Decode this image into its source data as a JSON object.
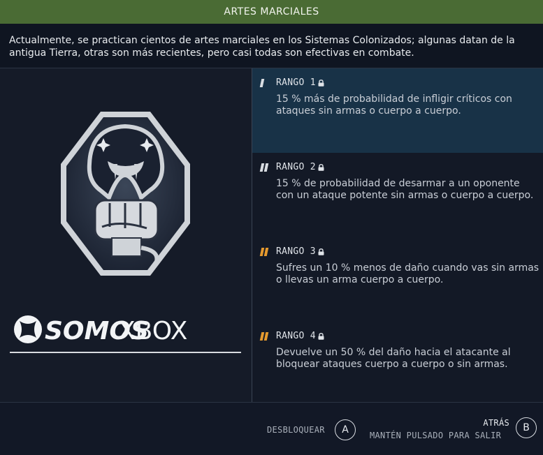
{
  "header": {
    "title": "ARTES MARCIALES"
  },
  "description": "Actualmente, se practican cientos de artes marciales en los Sistemas Colonizados; algunas datan de la antigua Tierra, otras son más recientes, pero casi todas son efectivas en combate.",
  "badge": {
    "icon": "snake-fist-emblem-icon"
  },
  "watermark": {
    "brand": "SOMOSXBOX",
    "text_bold": "SOMOS",
    "text_light": "XBOX"
  },
  "ranks": [
    {
      "label": "RANGO 1",
      "description": "15 % más de probabilidad de infligir críticos con ataques sin armas o cuerpo a cuerpo.",
      "bars": 1,
      "locked": true,
      "selected": true
    },
    {
      "label": "RANGO 2",
      "description": "15 % de probabilidad de desarmar a un oponente con un ataque potente sin armas o cuerpo a cuerpo.",
      "bars": 2,
      "locked": true,
      "selected": false
    },
    {
      "label": "RANGO 3",
      "description": "Sufres un 10 % menos de daño cuando vas sin armas o llevas un arma cuerpo a cuerpo.",
      "bars": 3,
      "locked": true,
      "selected": false
    },
    {
      "label": "RANGO 4",
      "description": "Devuelve un 50 % del daño hacia el atacante al bloquear ataques cuerpo a cuerpo o sin armas.",
      "bars": 4,
      "locked": true,
      "selected": false
    }
  ],
  "footer": {
    "unlock_label": "DESBLOQUEAR",
    "unlock_button": "A",
    "back_label": "ATRÁS",
    "back_hint": "MANTÉN PULSADO PARA SALIR",
    "back_button": "B"
  },
  "colors": {
    "header": "#4a6b34",
    "selected": "#183247",
    "bar_white": "#d9dde2",
    "bar_orange": "#e69a2e"
  }
}
